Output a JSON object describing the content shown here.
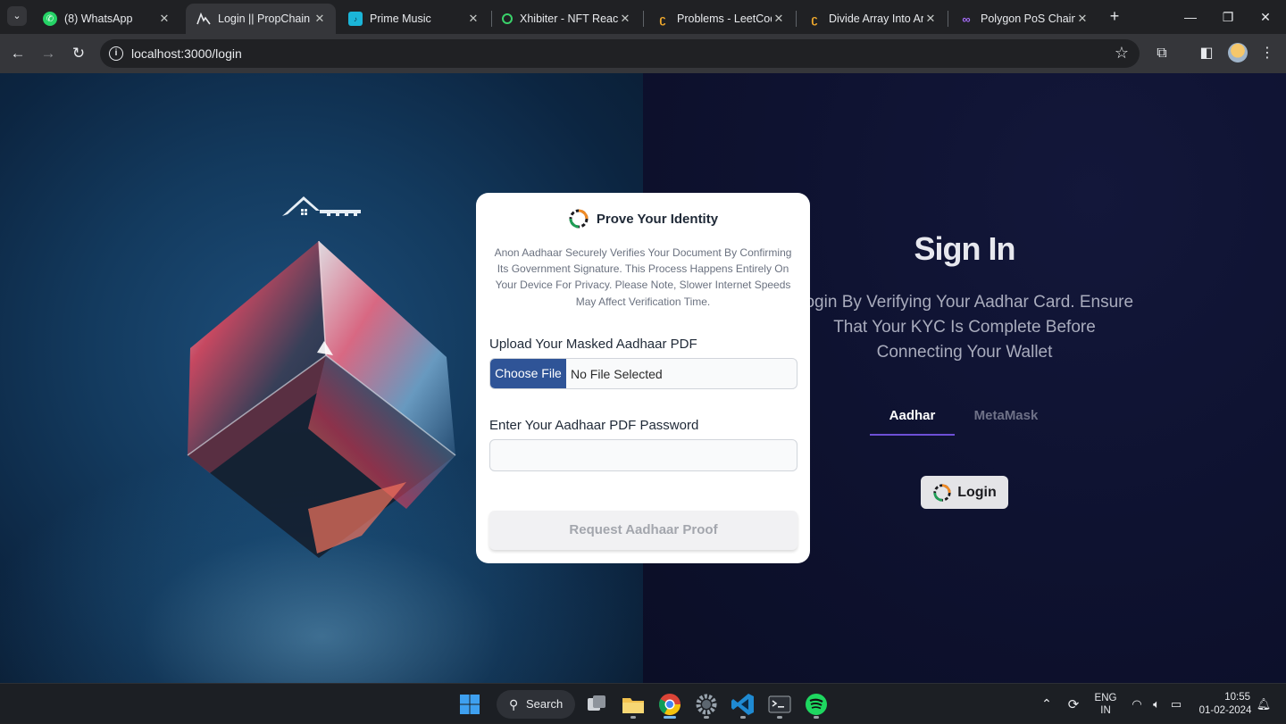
{
  "browser": {
    "tabs": [
      {
        "title": "(8) WhatsApp",
        "icon": "whatsapp-icon",
        "active": false
      },
      {
        "title": "Login || PropChain",
        "icon": "propchain-icon",
        "active": true
      },
      {
        "title": "Prime Music",
        "icon": "prime-music-icon",
        "active": false
      },
      {
        "title": "Xhibiter - NFT React",
        "icon": "xhibiter-icon",
        "active": false
      },
      {
        "title": "Problems - LeetCode",
        "icon": "leetcode-icon",
        "active": false
      },
      {
        "title": "Divide Array Into Arr",
        "icon": "leetcode-icon",
        "active": false
      },
      {
        "title": "Polygon PoS Chain Te",
        "icon": "polygon-icon",
        "active": false
      }
    ],
    "url": "localhost:3000/login"
  },
  "modal": {
    "title": "Prove Your Identity",
    "description": "Anon Aadhaar Securely Verifies Your Document By Confirming Its Government Signature. This Process Happens Entirely On Your Device For Privacy. Please Note, Slower Internet Speeds May Affect Verification Time.",
    "upload_label": "Upload Your Masked Aadhaar PDF",
    "choose_file_label": "Choose File",
    "no_file_text": "No File Selected",
    "password_label": "Enter Your Aadhaar PDF Password",
    "password_value": "",
    "request_button": "Request Aadhaar Proof"
  },
  "signin": {
    "title": "Sign In",
    "description": "Login By Verifying Your Aadhar Card. Ensure That Your KYC Is Complete Before Connecting Your Wallet",
    "tabs": [
      "Aadhar",
      "MetaMask"
    ],
    "active_tab": "Aadhar",
    "login_button": "Login"
  },
  "taskbar": {
    "search_label": "Search",
    "language_line1": "ENG",
    "language_line2": "IN",
    "time": "10:55",
    "date": "01-02-2024"
  },
  "colors": {
    "accent_tab_underline": "#6d4fd6",
    "choose_file_bg": "#2f5497",
    "right_panel_bg": "#0e1230",
    "left_panel_bg": "#133a5e"
  }
}
